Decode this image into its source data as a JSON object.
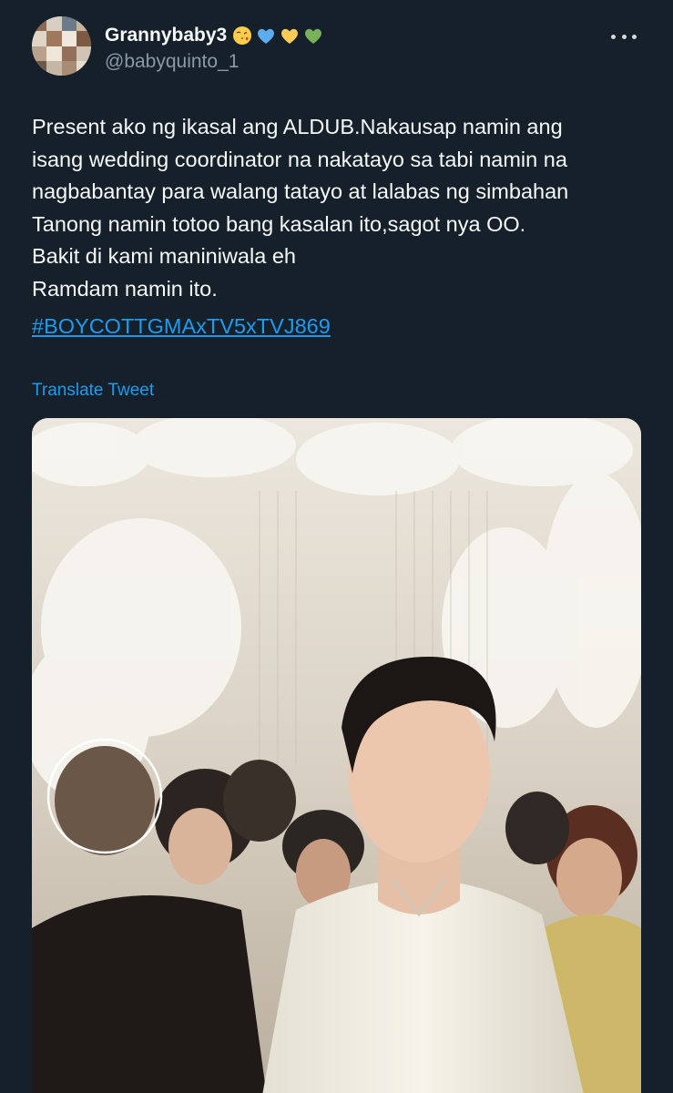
{
  "author": {
    "display_name": "Grannybaby3",
    "handle": "@babyquinto_1",
    "emojis": [
      "face-blowing-kiss-emoji",
      "blue-heart-emoji",
      "yellow-heart-emoji",
      "green-heart-emoji"
    ]
  },
  "tweet": {
    "text": "Present ako ng ikasal ang ALDUB.Nakausap namin ang\nisang wedding coordinator na nakatayo sa tabi namin na\nnagbabantay para walang tatayo at lalabas ng simbahan\nTanong namin totoo bang kasalan ito,sagot nya OO.\nBakit di kami maniniwala eh\nRamdam namin ito.",
    "hashtag": "#BOYCOTTGMAxTV5xTVJ869",
    "translate_label": "Translate Tweet"
  },
  "colors": {
    "background": "#15202b",
    "text": "#f7f9f9",
    "secondary": "#8b98a5",
    "link": "#1d9bf0"
  },
  "icons": {
    "more": "more-horizontal-icon"
  }
}
